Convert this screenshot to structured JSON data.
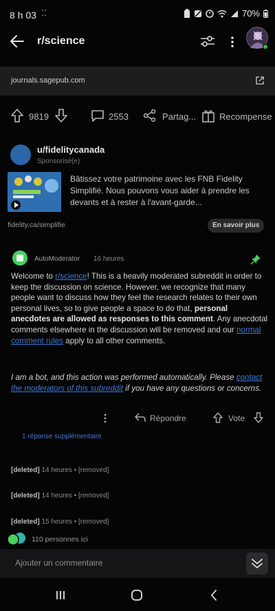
{
  "status_bar": {
    "time": "8 h 03",
    "battery": "70%"
  },
  "header": {
    "title": "r/science"
  },
  "link": {
    "domain": "journals.sagepub.com"
  },
  "post_actions": {
    "upvotes": "9819",
    "comments": "2553",
    "share_label": "Partag...",
    "award_label": "Recompense"
  },
  "ad": {
    "username": "u/fidelitycanada",
    "sponsored": "Sponsorisé(e)",
    "text": "Bâtissez votre patrimoine avec les FNB Fidelity Simplifié. Nous pouvons vous aider à prendre les devants et à rester à l'avant-garde...",
    "link": "fidelity.ca/simplifie",
    "cta": "En savoir plus"
  },
  "comment": {
    "author": "AutoModerator",
    "time": "16 heures",
    "p1_a": "Welcome to ",
    "p1_link1": "r/science",
    "p1_b": "! This is a heavily moderated subreddit in order to keep the discussion on science. However, we recognize that many people want to discuss how they feel the research relates to their own personal lives, so to give people a space to do that, ",
    "p1_bold": "personal anecdotes are allowed as responses to this comment",
    "p1_c": ". Any anecdotal comments elsewhere in the discussion will be removed and our ",
    "p1_link2": "normal comment rules",
    "p1_d": " apply to all other comments.",
    "p2_a": "I am a bot, and this action was performed automatically. Please ",
    "p2_link": "contact the moderators of this subreddit",
    "p2_b": " if you have any questions or concerns.",
    "reply_label": "Répondre",
    "vote_label": "Vote",
    "more_replies": "1 réponse supplémentaire"
  },
  "deleted_comments": [
    {
      "author": "[deleted]",
      "meta": "14 heures • [removed]"
    },
    {
      "author": "[deleted]",
      "meta": "14 heures • [removed]"
    },
    {
      "author": "[deleted]",
      "meta": "15 heures • [removed]"
    }
  ],
  "online": {
    "text": "110 personnes ici"
  },
  "comment_input": {
    "placeholder": "Ajouter un commentaire"
  },
  "colors": {
    "link_blue": "#3f78d6",
    "online_green": "#46d160",
    "background": "#050505"
  }
}
